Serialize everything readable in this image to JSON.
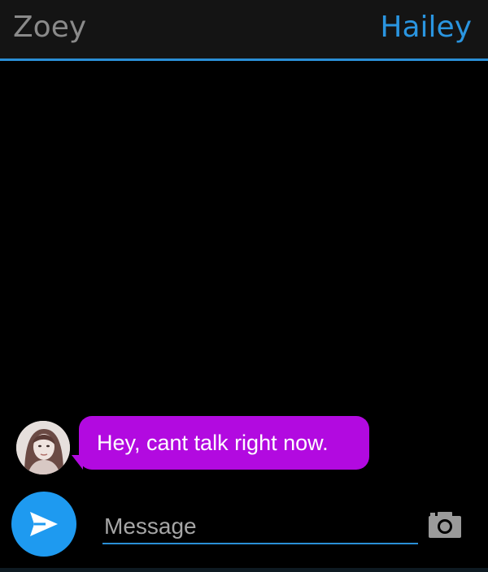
{
  "header": {
    "left_name": "Zoey",
    "right_name": "Hailey"
  },
  "messages": [
    {
      "sender": "Hailey",
      "text": "Hey, cant talk right now."
    }
  ],
  "composer": {
    "placeholder": "Message",
    "send_icon": "send-icon",
    "camera_icon": "camera-icon"
  },
  "colors": {
    "header_bg": "#141414",
    "accent": "#2a95e0",
    "bubble": "#b20ae0",
    "send_button": "#1e9af0",
    "background": "#000000"
  }
}
